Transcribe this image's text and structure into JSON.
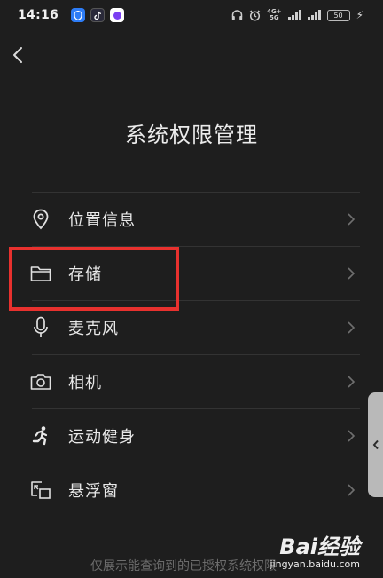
{
  "status_bar": {
    "time": "14:16",
    "network": [
      "4G+",
      "5G"
    ],
    "battery": "50"
  },
  "page": {
    "title": "系统权限管理"
  },
  "permissions": [
    {
      "label": "位置信息",
      "icon": "location-pin-icon"
    },
    {
      "label": "存储",
      "icon": "folder-icon"
    },
    {
      "label": "麦克风",
      "icon": "microphone-icon"
    },
    {
      "label": "相机",
      "icon": "camera-icon"
    },
    {
      "label": "运动健身",
      "icon": "running-person-icon"
    },
    {
      "label": "悬浮窗",
      "icon": "floating-window-icon"
    }
  ],
  "footnote": "仅展示能查询到的已授权系统权限",
  "watermark": {
    "logo": "Bai经验",
    "url": "jingyan.baidu.com"
  },
  "colors": {
    "background": "#1e1e1e",
    "highlight": "#e8312e",
    "text": "#e8e8e8"
  }
}
